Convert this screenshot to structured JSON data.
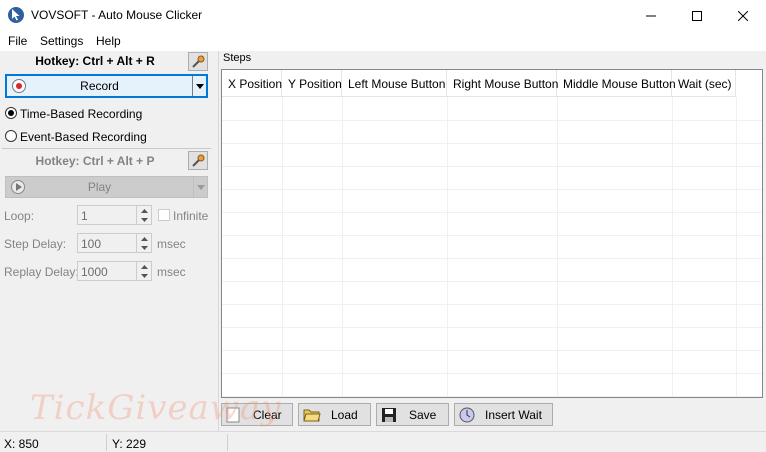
{
  "window": {
    "title": "VOVSOFT - Auto Mouse Clicker",
    "controls": {
      "minimize": "minimize-icon",
      "maximize": "maximize-icon",
      "close": "close-icon"
    }
  },
  "menu": {
    "items": [
      "File",
      "Settings",
      "Help"
    ]
  },
  "record_panel": {
    "hotkey": "Hotkey: Ctrl + Alt + R",
    "record_label": "Record",
    "modes": [
      {
        "label": "Time-Based Recording",
        "checked": true
      },
      {
        "label": "Event-Based Recording",
        "checked": false
      }
    ]
  },
  "play_panel": {
    "hotkey": "Hotkey: Ctrl + Alt + P",
    "play_label": "Play",
    "loop": {
      "label": "Loop:",
      "value": "1",
      "infinite_label": "Infinite"
    },
    "step_delay": {
      "label": "Step Delay:",
      "value": "100",
      "unit": "msec"
    },
    "replay_delay": {
      "label": "Replay Delay:",
      "value": "1000",
      "unit": "msec"
    }
  },
  "steps": {
    "label": "Steps",
    "columns": [
      "X Position",
      "Y Position",
      "Left Mouse Button",
      "Right Mouse Button",
      "Middle Mouse Button",
      "Wait (sec)"
    ],
    "rows": []
  },
  "toolbar": {
    "clear": "Clear",
    "load": "Load",
    "save": "Save",
    "insert_wait": "Insert Wait"
  },
  "watermark": "TickGiveaway",
  "status": {
    "x": "X: 850",
    "y": "Y: 229"
  },
  "colors": {
    "focus": "#0078d7",
    "record_dot": "#d62828",
    "panel_bg": "#f0f0f0"
  }
}
